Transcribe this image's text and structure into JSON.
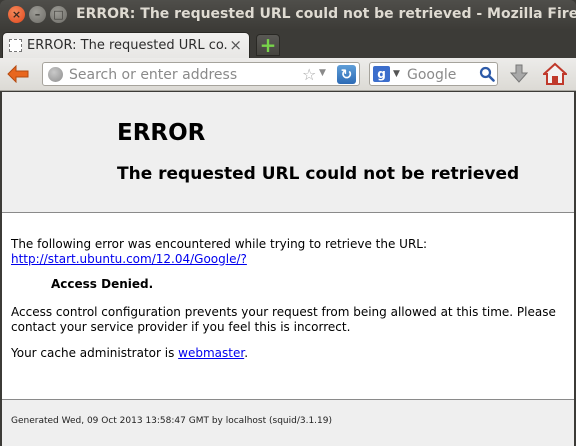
{
  "window": {
    "title": "ERROR: The requested URL could not be retrieved - Mozilla Firefox"
  },
  "tab": {
    "title": "ERROR: The requested URL co...",
    "close_glyph": "×"
  },
  "newtab": {
    "glyph": "+"
  },
  "navbar": {
    "url_placeholder": "Search or enter address",
    "search_placeholder": "Google",
    "search_engine_letter": "g"
  },
  "page": {
    "heading": "ERROR",
    "subheading": "The requested URL could not be retrieved",
    "intro": "The following error was encountered while trying to retrieve the URL:",
    "url_link": "http://start.ubuntu.com/12.04/Google/?",
    "access_denied": "Access Denied.",
    "explanation": "Access control configuration prevents your request from being allowed at this time. Please contact your service provider if you feel this is incorrect.",
    "cache_admin_prefix": "Your cache administrator is ",
    "cache_admin_link": "webmaster",
    "cache_admin_suffix": ".",
    "footer": "Generated Wed, 09 Oct 2013 13:58:47 GMT by localhost (squid/3.1.19)"
  },
  "colors": {
    "accent_orange": "#e8661e",
    "link_blue": "#0000ee",
    "header_gray": "#efefef"
  }
}
